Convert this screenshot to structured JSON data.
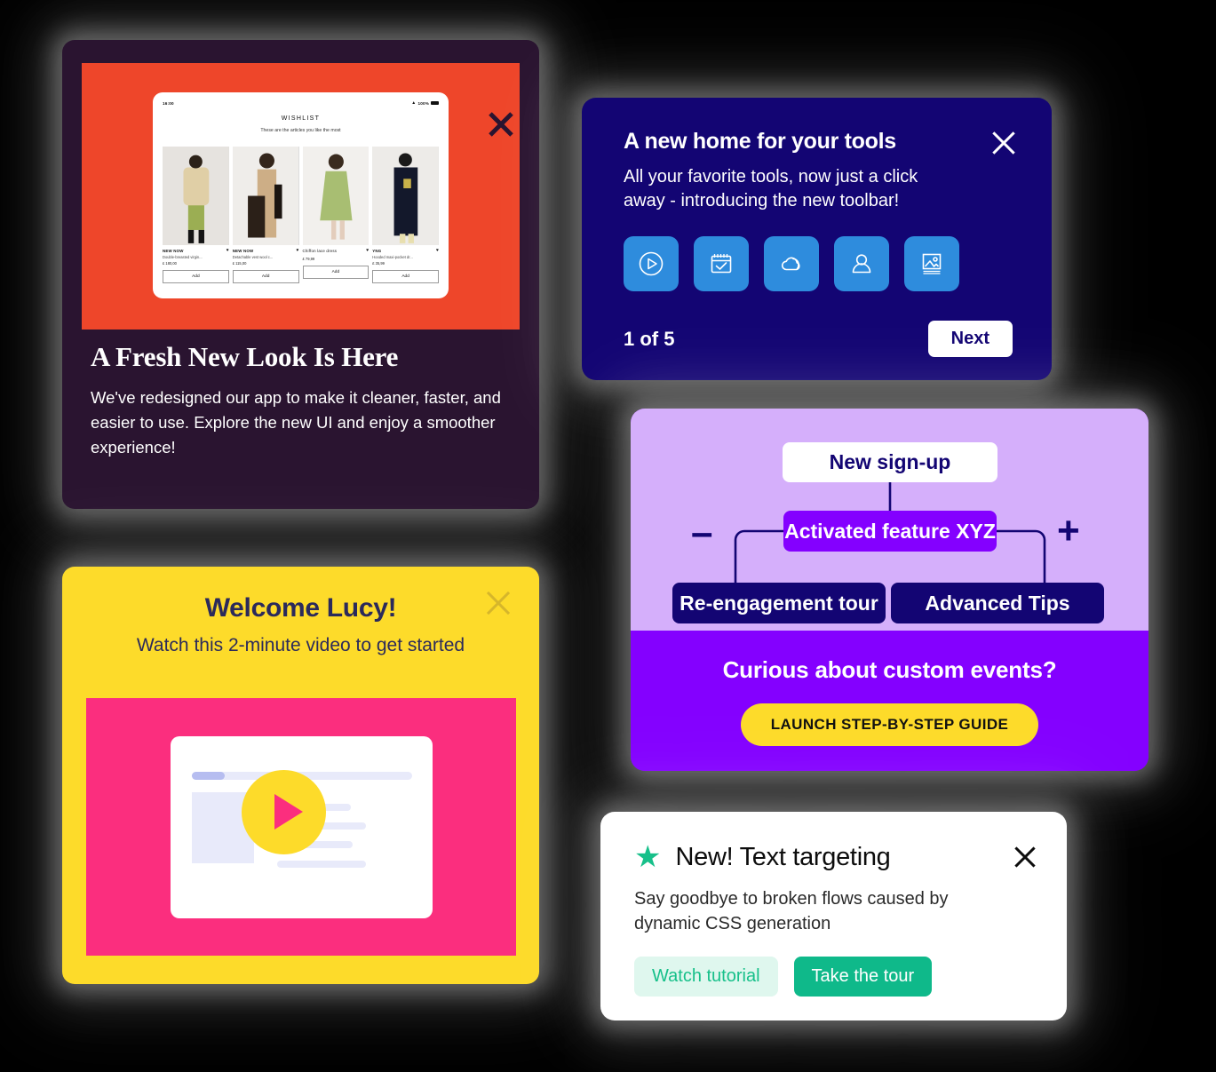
{
  "colors": {
    "page_background": "#000000",
    "plum": "#2A1430",
    "red": "#EE462A",
    "navy": "#130573",
    "tile_blue": "#2E8CDD",
    "light_purple": "#D5AFFB",
    "purple": "#8400FF",
    "yellow": "#FDDB2A",
    "pink": "#FB2E7E",
    "green": "#0FB98A",
    "green_light": "#DFF7EE"
  },
  "fresh_look_card": {
    "close_icon": "close-icon",
    "heading": "A Fresh New Look Is Here",
    "body": "We've redesigned our app to make it cleaner, faster, and easier to use. Explore the new UI and enjoy a smoother experience!",
    "wishlist": {
      "status_time": "16:00",
      "status_battery": "100%",
      "title": "WISHLIST",
      "subtitle": "These are the articles you like the most",
      "add_label": "Add",
      "items": [
        {
          "brand": "NEW NOW",
          "desc": "Double-breasted virgin...",
          "price": "£ 180,00"
        },
        {
          "brand": "NEW NOW",
          "desc": "Detachable vest wool c...",
          "price": "£ 115,00"
        },
        {
          "brand": "Chiffon lace dress",
          "desc": "",
          "price": "£ 79,99"
        },
        {
          "brand": "YNG",
          "desc": "Hooded maxi-pocket dr...",
          "price": "£ 35,99"
        }
      ]
    }
  },
  "toolbar_card": {
    "title": "A new home for your tools",
    "body": "All your favorite tools, now just a click away - introducing the new toolbar!",
    "close_icon": "close-icon",
    "tools": [
      {
        "icon": "play-circle-icon"
      },
      {
        "icon": "calendar-check-icon"
      },
      {
        "icon": "cloud-icon"
      },
      {
        "icon": "user-icon"
      },
      {
        "icon": "image-icon"
      }
    ],
    "step_counter": "1 of 5",
    "next_label": "Next"
  },
  "events_card": {
    "flow": {
      "signup": "New sign-up",
      "feature": "Activated feature XYZ",
      "reengagement": "Re-engagement tour",
      "advanced_tips": "Advanced Tips",
      "minus_symbol": "–",
      "plus_symbol": "+"
    },
    "cta_heading": "Curious about custom events?",
    "cta_button": "LAUNCH STEP-BY-STEP GUIDE"
  },
  "welcome_card": {
    "heading": "Welcome Lucy!",
    "subheading": "Watch this 2-minute video to get started",
    "close_icon": "close-icon",
    "play_icon": "play-icon"
  },
  "targeting_card": {
    "star_icon": "star-icon",
    "title": "New! Text targeting",
    "body": "Say goodbye to broken flows caused by dynamic CSS generation",
    "close_icon": "close-icon",
    "secondary_button": "Watch tutorial",
    "primary_button": "Take the tour"
  }
}
